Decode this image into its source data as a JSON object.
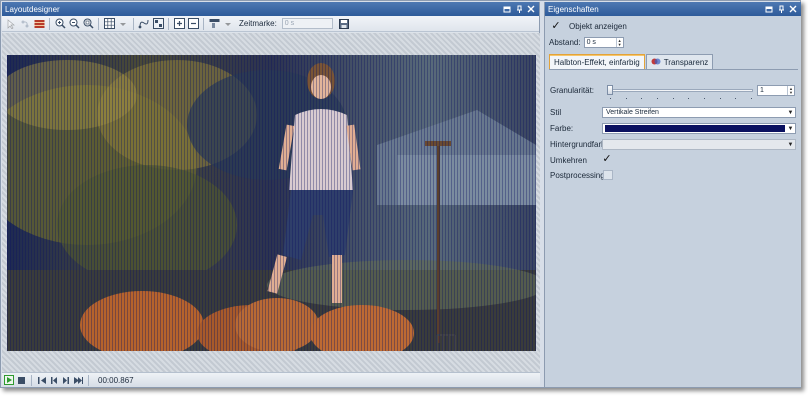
{
  "layoutdesigner": {
    "title": "Layoutdesigner",
    "zeitmarke_label": "Zeitmarke:",
    "zeitmarke_value": "0 s"
  },
  "transport": {
    "time": "00:00.867"
  },
  "properties": {
    "title": "Eigenschaften",
    "show_object_label": "Objekt anzeigen",
    "show_object_checked": true,
    "abstand_label": "Abstand:",
    "abstand_value": "0 s",
    "tabs": [
      {
        "label": "Halbton-Effekt, einfarbig",
        "active": true
      },
      {
        "label": "Transparenz",
        "active": false
      }
    ],
    "granularitaet_label": "Granularität:",
    "granularitaet_value": "1",
    "granularitaet_level": 0.0,
    "stil_label": "Stil",
    "stil_value": "Vertikale Streifen",
    "farbe_label": "Farbe:",
    "farbe_color": "#0a1160",
    "hintergrundfarbe_label": "Hintergrundfarbe:",
    "umkehren_label": "Umkehren",
    "umkehren_checked": true,
    "postprocessing_label": "Postprocessing",
    "postprocessing_checked": false
  },
  "colors": {
    "titlebar": "#2e5b9a",
    "active_tab_accent": "#e3a33a",
    "play_green": "#2e9a2e"
  }
}
